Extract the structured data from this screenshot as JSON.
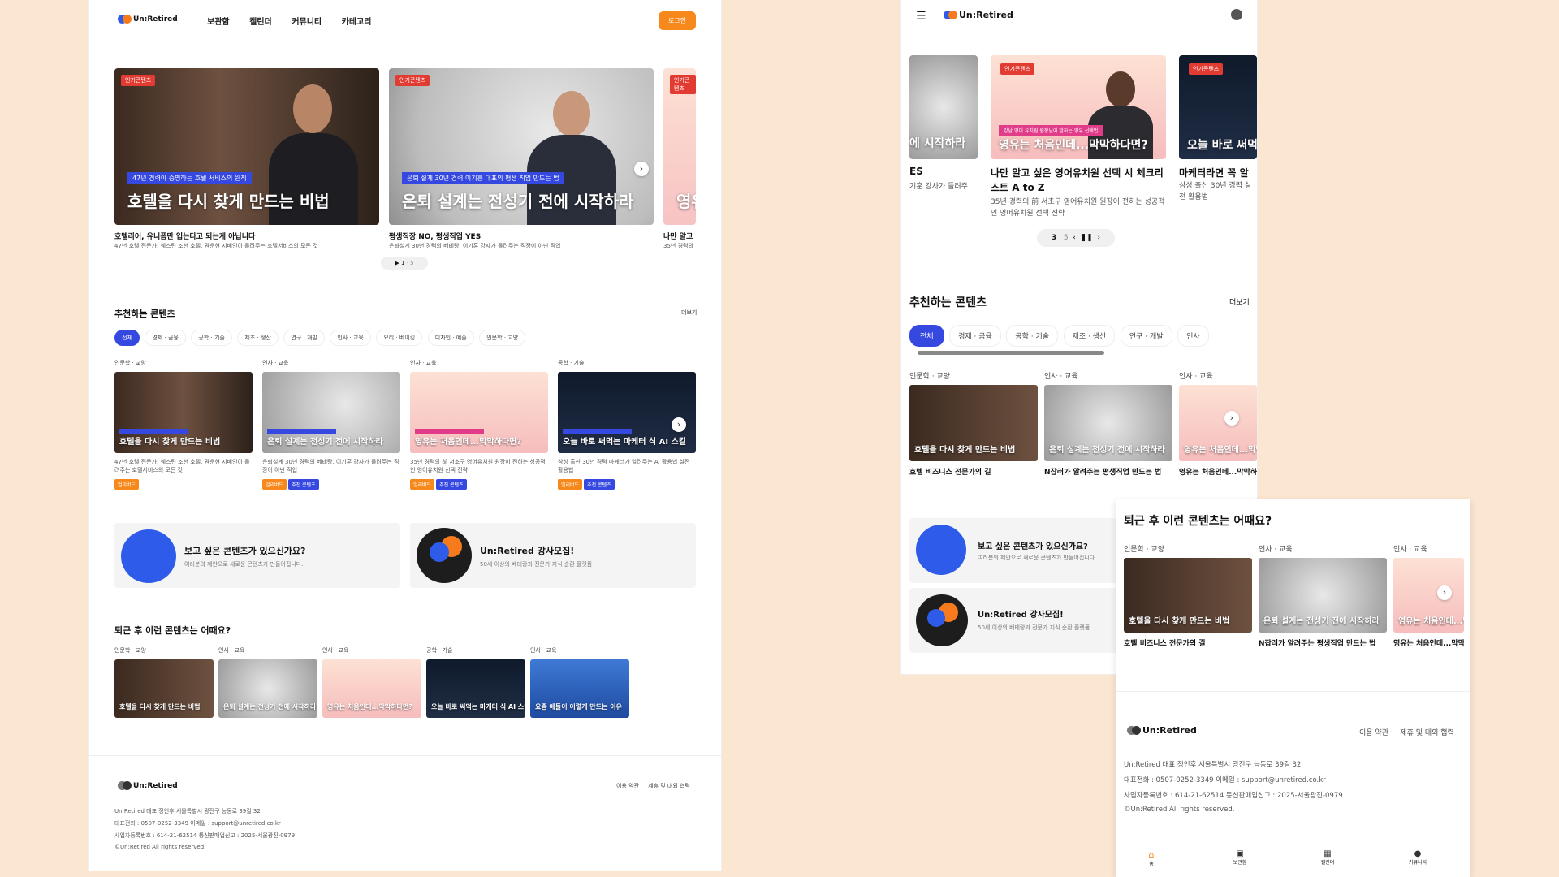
{
  "brand": {
    "name": "Un:Retired"
  },
  "desktop": {
    "nav": [
      "보관함",
      "캘린더",
      "커뮤니티",
      "카테고리"
    ],
    "login_label": "로그인",
    "hero_cards": [
      {
        "badge": "인기콘텐츠",
        "tag": "47년 경력이 증명하는 호텔 서비스의 원칙",
        "title": "호텔을 다시 찾게 만드는 비법",
        "caption": "호텔리어, 유니폼만 입는다고 되는게 아닙니다",
        "sub": "47년 호텔 전문가: 웨스틴 조선 호텔, 권운현 지배인이 들려주는 호텔서비스의 모든 것"
      },
      {
        "badge": "인기콘텐츠",
        "tag": "은퇴 설계 30년 경력 이기훈 대표의 평생 직업 만드는 법",
        "title": "은퇴 설계는 전성기 전에 시작하라",
        "caption": "평생직장 NO, 평생직업 YES",
        "sub": "은퇴설계 30년 경력의 베테랑, 이기훈 강사가 들려주는 직장이 아닌 직업"
      },
      {
        "badge": "인기콘텐츠",
        "title": "영유",
        "caption": "나만 알고",
        "sub": "35년 경력의"
      }
    ],
    "pager": {
      "current": "1",
      "total": "5"
    },
    "recommend": {
      "title": "추천하는 콘텐츠",
      "more": "더보기",
      "chips": [
        "전체",
        "경제 · 금융",
        "공학 · 기술",
        "제조 · 생산",
        "연구 · 개발",
        "인사 · 교육",
        "요리 · 베이킹",
        "디자인 · 예술",
        "인문학 · 교양"
      ],
      "cards": [
        {
          "cat": "인문학 · 교양",
          "title": "호텔을 다시 찾게 만드는 비법",
          "desc": "47년 호텔 전문가: 웨스틴 조선 호텔, 권운현 지배인이 들려주는 호텔서비스의 모든 것",
          "badges": [
            "얼리버드"
          ]
        },
        {
          "cat": "인사 · 교육",
          "title": "은퇴 설계는 전성기 전에 시작하라",
          "desc": "은퇴설계 30년 경력의 베테랑, 이기훈 강사가 들려주는 직장이 아닌 직업",
          "badges": [
            "얼리버드",
            "추천 콘텐츠"
          ]
        },
        {
          "cat": "인사 · 교육",
          "title": "영유는 처음인데...막막하다면?",
          "desc": "35년 경력의 前 서초구 영어유치원 원장이 전하는 성공적인 영어유치원 선택 전략",
          "badges": [
            "얼리버드",
            "추천 콘텐츠"
          ]
        },
        {
          "cat": "공학 · 기술",
          "title": "오늘 바로 써먹는 마케터 식 AI 스킬",
          "desc": "삼성 출신 30년 경력 마케터가 알려주는 AI 활용법 실전 활용법",
          "badges": [
            "얼리버드",
            "추천 콘텐츠"
          ]
        }
      ]
    },
    "promo": [
      {
        "title": "보고 싶은 콘텐츠가 있으신가요?",
        "sub": "여러분의 제안으로 새로운 콘텐츠가 만들어집니다."
      },
      {
        "title": "Un:Retired 강사모집!",
        "sub": "50세 이상의 베테랑과 전문가 지식 순환 플랫폼"
      }
    ],
    "after_work": {
      "title": "퇴근 후 이런 콘텐츠는 어때요?",
      "cards": [
        {
          "cat": "인문학 · 교양",
          "title": "호텔을 다시 찾게 만드는 비법"
        },
        {
          "cat": "인사 · 교육",
          "title": "은퇴 설계는 전성기 전에 시작하라"
        },
        {
          "cat": "인사 · 교육",
          "title": "영유는 처음인데...막막하다면?"
        },
        {
          "cat": "공학 · 기술",
          "title": "오늘 바로 써먹는 마케터 식 AI 스킬"
        },
        {
          "cat": "인사 · 교육",
          "title": "요즘 애들이 이렇게 만드는 이유"
        }
      ]
    },
    "footer": {
      "links": [
        "이용 약관",
        "제휴 및 대외 협력"
      ],
      "lines": [
        "Un:Retired    대표 정인후    서울특별시 광진구 능동로 39길 32",
        "대표전화 : 0507-0252-3349    이메일 : support@unretired.co.kr",
        "사업자등록번호 : 614-21-62514    통신판매업신고 : 2025-서울광진-0979",
        "©Un:Retired All rights reserved."
      ]
    }
  },
  "mobile": {
    "hero_cards": [
      {
        "title": "에 시작하라",
        "caption": "ES",
        "sub": "기훈 강사가 들려주"
      },
      {
        "badge": "인기콘텐츠",
        "tag": "강남 영어 유치원 원장님이 말하는 영유 선택법",
        "title": "영유는 처음인데...막막하다면?",
        "caption": "나만 알고 싶은 영어유치원 선택 시 체크리스트 A to Z",
        "sub": "35년 경력의 前 서초구 영어유치원 원장이 전하는 성공적인 영어유치원 선택 전략"
      },
      {
        "badge": "인기콘텐츠",
        "title": "오늘 바로 써먹",
        "caption": "마케터라면 꼭 알",
        "sub": "삼성 출신 30년 경력 실전 활용법"
      }
    ],
    "pager": {
      "current": "3",
      "total": "5"
    },
    "recommend": {
      "title": "추천하는 콘텐츠",
      "more": "더보기",
      "chips": [
        "전체",
        "경제 · 금융",
        "공학 · 기술",
        "제조 · 생산",
        "연구 · 개발",
        "인사"
      ],
      "cards": [
        {
          "cat": "인문학 · 교양",
          "title": "호텔을 다시 찾게 만드는 비법",
          "caption": "호텔 비즈니스 전문가의 길"
        },
        {
          "cat": "인사 · 교육",
          "title": "은퇴 설계는 전성기 전에 시작하라",
          "caption": "N잡러가 알려주는 평생직업 만드는 법"
        },
        {
          "cat": "인사 · 교육",
          "title": "영유는 처음인데...막막",
          "caption": "영유는 처음인데...막막하"
        }
      ]
    },
    "promo": [
      {
        "title": "보고 싶은 콘텐츠가 있으신가요?",
        "sub": "여러분의 제안으로 새로운 콘텐츠가 만들어집니다."
      },
      {
        "title": "Un:Retired 강사모집!",
        "sub": "50세 이상의 베테랑과 전문가 지식 순환 플랫폼"
      }
    ]
  },
  "mobile2": {
    "title": "퇴근 후 이런 콘텐츠는 어때요?",
    "cards": [
      {
        "cat": "인문학 · 교양",
        "title": "호텔을 다시 찾게 만드는 비법",
        "caption": "호텔 비즈니스 전문가의 길"
      },
      {
        "cat": "인사 · 교육",
        "title": "은퇴 설계는 전성기 전에 시작하라",
        "caption": "N잡러가 알려주는 평생직업 만드는 법"
      },
      {
        "cat": "인사 · 교육",
        "title": "영유는 처음인데...막막",
        "caption": "영유는 처음인데...막막하"
      }
    ],
    "footer": {
      "links": [
        "이용 약관",
        "제휴 및 대외 협력"
      ],
      "lines": [
        "Un:Retired    대표 정인후    서울특별시 광진구 능동로 39길 32",
        "대표전화 : 0507-0252-3349    이메일 : support@unretired.co.kr",
        "사업자등록번호 : 614-21-62514    통신판매업신고 : 2025-서울광진-0979",
        "©Un:Retired All rights reserved."
      ]
    },
    "tabbar": [
      "홈",
      "보관함",
      "캘린더",
      "커뮤니티"
    ]
  }
}
